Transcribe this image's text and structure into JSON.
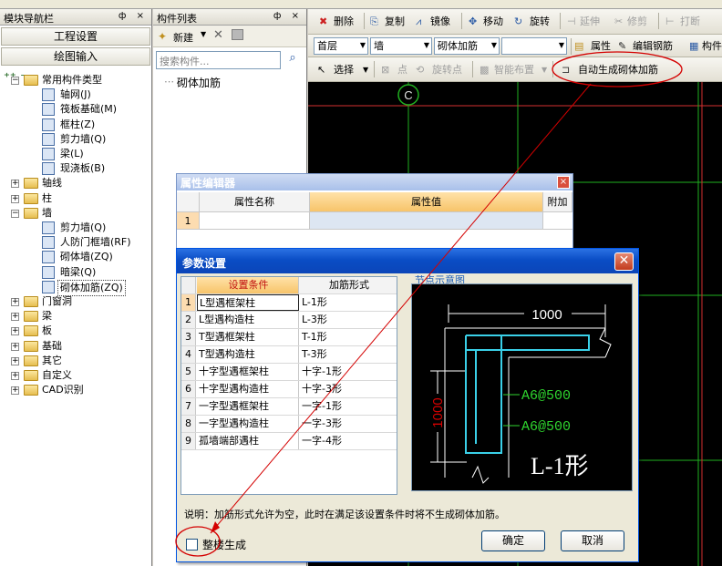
{
  "nav": {
    "title": "模块导航栏",
    "pin": "ф",
    "close": "×",
    "btn_project": "工程设置",
    "btn_draw": "绘图输入",
    "tree": [
      {
        "label": "常用构件类型",
        "level": 0,
        "expand": "−",
        "type": "folder"
      },
      {
        "label": "轴网(J)",
        "level": 1,
        "type": "grid"
      },
      {
        "label": "筏板基础(M)",
        "level": 1,
        "type": "slab"
      },
      {
        "label": "框柱(Z)",
        "level": 1,
        "type": "column"
      },
      {
        "label": "剪力墙(Q)",
        "level": 1,
        "type": "wall"
      },
      {
        "label": "梁(L)",
        "level": 1,
        "type": "beam"
      },
      {
        "label": "现浇板(B)",
        "level": 1,
        "type": "plate"
      },
      {
        "label": "轴线",
        "level": 0,
        "expand": "+",
        "type": "folder"
      },
      {
        "label": "柱",
        "level": 0,
        "expand": "+",
        "type": "folder"
      },
      {
        "label": "墙",
        "level": 0,
        "expand": "−",
        "type": "folder"
      },
      {
        "label": "剪力墙(Q)",
        "level": 1,
        "type": "wall"
      },
      {
        "label": "人防门框墙(RF)",
        "level": 1,
        "type": "door"
      },
      {
        "label": "砌体墙(ZQ)",
        "level": 1,
        "type": "brick"
      },
      {
        "label": "暗梁(Q)",
        "level": 1,
        "type": "beam"
      },
      {
        "label": "砌体加筋(ZQ)",
        "level": 1,
        "type": "rebar",
        "selected": true
      },
      {
        "label": "门窗洞",
        "level": 0,
        "expand": "+",
        "type": "folder"
      },
      {
        "label": "梁",
        "level": 0,
        "expand": "+",
        "type": "folder"
      },
      {
        "label": "板",
        "level": 0,
        "expand": "+",
        "type": "folder"
      },
      {
        "label": "基础",
        "level": 0,
        "expand": "+",
        "type": "folder"
      },
      {
        "label": "其它",
        "level": 0,
        "expand": "+",
        "type": "folder"
      },
      {
        "label": "自定义",
        "level": 0,
        "expand": "+",
        "type": "folder"
      },
      {
        "label": "CAD识别",
        "level": 0,
        "expand": "+",
        "type": "folder"
      }
    ]
  },
  "comp": {
    "title": "构件列表",
    "new_label": "新建",
    "search_placeholder": "搜索构件...",
    "item": "砌体加筋"
  },
  "toolbar1": {
    "delete": "删除",
    "copy": "复制",
    "mirror": "镜像",
    "move": "移动",
    "rotate": "旋转",
    "extend": "延伸",
    "trim": "修剪",
    "break": "打断"
  },
  "toolbar2": {
    "floor": "首层",
    "category": "墙",
    "element": "砌体加筋",
    "blank": "",
    "property": "属性",
    "edit_rebar": "编辑钢筋",
    "comp_short": "构件"
  },
  "toolbar3": {
    "select": "选择",
    "point": "点",
    "rotate_point": "旋转点",
    "smart_layout": "智能布置",
    "auto_generate": "自动生成砌体加筋"
  },
  "canvas": {
    "axis_label": "C"
  },
  "prop_editor": {
    "title": "属性编辑器",
    "col_name": "属性名称",
    "col_value": "属性值",
    "col_extra": "附加",
    "row_no": "1"
  },
  "param_dialog": {
    "title": "参数设置",
    "close": "✕",
    "col_condition": "设置条件",
    "col_form": "加筋形式",
    "rows": [
      {
        "n": "1",
        "cond": "L型遇框架柱",
        "form": "L-1形"
      },
      {
        "n": "2",
        "cond": "L型遇构造柱",
        "form": "L-3形"
      },
      {
        "n": "3",
        "cond": "T型遇框架柱",
        "form": "T-1形"
      },
      {
        "n": "4",
        "cond": "T型遇构造柱",
        "form": "T-3形"
      },
      {
        "n": "5",
        "cond": "十字型遇框架柱",
        "form": "十字-1形"
      },
      {
        "n": "6",
        "cond": "十字型遇构造柱",
        "form": "十字-3形"
      },
      {
        "n": "7",
        "cond": "一字型遇框架柱",
        "form": "一字-1形"
      },
      {
        "n": "8",
        "cond": "一字型遇构造柱",
        "form": "一字-3形"
      },
      {
        "n": "9",
        "cond": "孤墙端部遇柱",
        "form": "一字-4形"
      }
    ],
    "diagram_label": "节点示意图",
    "dim_top": "1000",
    "dim_left": "1000",
    "rebar1": "A6@500",
    "rebar2": "A6@500",
    "shape": "L-1形",
    "note": "说明：加筋形式允许为空，此时在满足该设置条件时将不生成砌体加筋。",
    "ok": "确定",
    "cancel": "取消",
    "checkbox_label": "整楼生成"
  },
  "colors": {
    "accent_red": "#d40000",
    "title_blue": "#0a4dc5",
    "canvas_bg": "#000000",
    "cad_green": "#2fd52f",
    "cyan": "#3ad0e8"
  }
}
